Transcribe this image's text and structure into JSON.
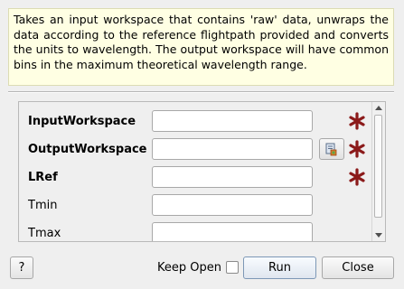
{
  "description": "Takes an input workspace that contains 'raw' data, unwraps the data according to the reference flightpath provided and converts the units to wavelength. The output workspace will have common bins in the maximum theoretical wavelength range.",
  "properties": [
    {
      "label": "InputWorkspace",
      "value": "",
      "required": true,
      "bold": true
    },
    {
      "label": "OutputWorkspace",
      "value": "",
      "required": true,
      "bold": true
    },
    {
      "label": "LRef",
      "value": "",
      "required": true,
      "bold": true
    },
    {
      "label": "Tmin",
      "value": "",
      "required": false,
      "bold": false
    },
    {
      "label": "Tmax",
      "value": "",
      "required": false,
      "bold": false
    }
  ],
  "buttons": {
    "help": "?",
    "keep_open": "Keep Open",
    "run": "Run",
    "close": "Close"
  },
  "keep_open_checked": false,
  "colors": {
    "required_star": "#8b1a1a",
    "description_bg": "#ffffe3"
  },
  "icons": {
    "required": "asterisk-icon",
    "browse": "workspace-browse-icon"
  }
}
